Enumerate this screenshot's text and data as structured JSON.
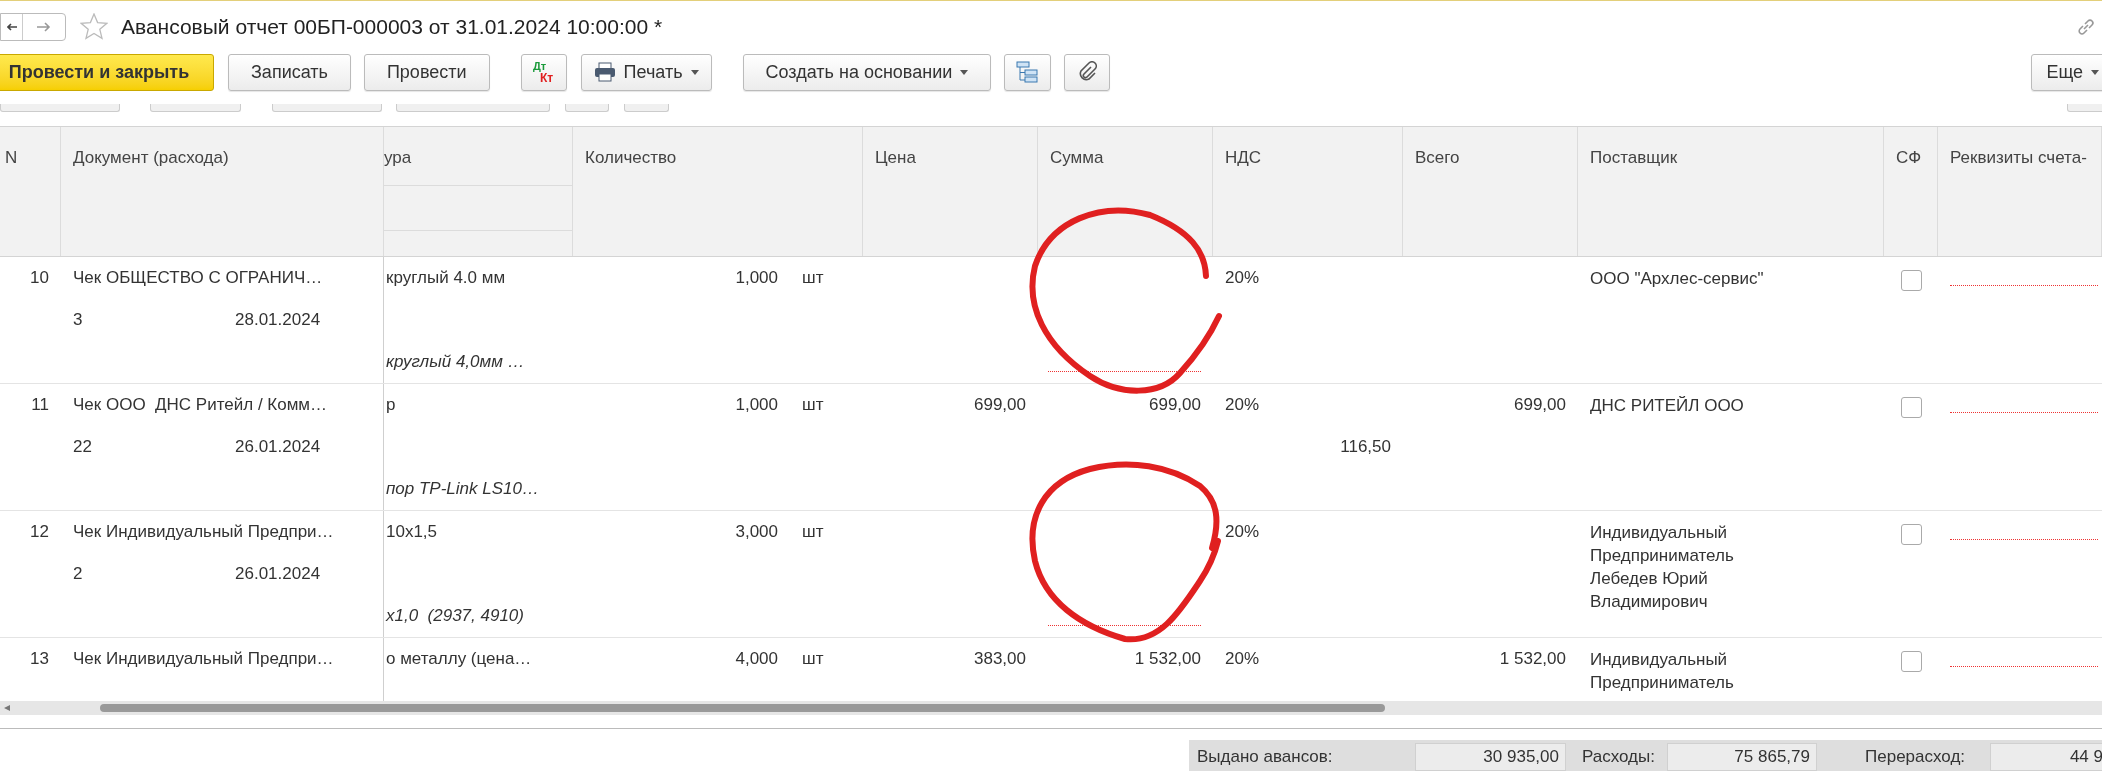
{
  "window": {
    "title": "Авансовый отчет 00БП-000003 от 31.01.2024 10:00:00 *"
  },
  "toolbar": {
    "buttons": [
      {
        "kind": "primary",
        "label": "Провести и закрыть"
      },
      {
        "kind": "plain",
        "label": "Записать"
      },
      {
        "kind": "plain",
        "label": "Провести"
      },
      {
        "kind": "dtkt",
        "label": "Дт",
        "sublabel": "Кт"
      },
      {
        "kind": "print",
        "label": "Печать",
        "dropdown": true
      },
      {
        "kind": "plain",
        "label": "Создать на основании",
        "dropdown": true
      },
      {
        "kind": "structure"
      },
      {
        "kind": "attach"
      }
    ],
    "more": {
      "label": "Еще",
      "dropdown": true
    }
  },
  "table": {
    "columns": [
      {
        "label": "N"
      },
      {
        "label": "Документ (расхода)"
      },
      {
        "label": "ура"
      },
      {
        "label": "Количество"
      },
      {
        "label": "Цена"
      },
      {
        "label": "Сумма"
      },
      {
        "label": "НДС"
      },
      {
        "label": "Всего"
      },
      {
        "label": "Поставщик"
      },
      {
        "label": "СФ"
      },
      {
        "label": "Реквизиты счета-"
      }
    ],
    "rows": [
      {
        "n": "10",
        "document": "Чек ОБЩЕСТВО С ОГРАНИЧ…",
        "doc_number": "3",
        "doc_date": "28.01.2024",
        "item": "круглый 4.0 мм",
        "item_full": "круглый 4,0мм …",
        "quantity": "1,000",
        "unit": "шт",
        "vat_rate": "20%",
        "supplier": "ООО \"Архлес-сервис\"",
        "invoice": false
      },
      {
        "n": "11",
        "document": "Чек ООО  ДНС Ритейл / Комм…",
        "doc_number": "22",
        "doc_date": "26.01.2024",
        "item": "р",
        "item_full": "пор TP-Link LS10…",
        "quantity": "1,000",
        "unit": "шт",
        "price": "699,00",
        "sum": "699,00",
        "vat_rate": "20%",
        "vat_amount": "116,50",
        "total": "699,00",
        "supplier": "ДНС РИТЕЙЛ ООО",
        "invoice": false
      },
      {
        "n": "12",
        "document": "Чек Индивидуальный Предпри…",
        "doc_number": "2",
        "doc_date": "26.01.2024",
        "item": "10x1,5",
        "item_full": "x1,0  (2937, 4910)",
        "quantity": "3,000",
        "unit": "шт",
        "vat_rate": "20%",
        "supplier": "Индивидуальный Предприниматель Лебедев Юрий Владимирович",
        "invoice": false
      },
      {
        "n": "13",
        "document": "Чек Индивидуальный Предпри…",
        "item": "о металлу (цена…",
        "quantity": "4,000",
        "unit": "шт",
        "price": "383,00",
        "sum": "1 532,00",
        "vat_rate": "20%",
        "total": "1 532,00",
        "supplier": "Индивидуальный Предприниматель",
        "invoice": false
      }
    ]
  },
  "totals": [
    {
      "label": "Выдано авансов:",
      "value": "30 935,00"
    },
    {
      "label": "Расходы:",
      "value": "75 865,79"
    },
    {
      "label": "Перерасход:",
      "value": "44 9"
    }
  ]
}
